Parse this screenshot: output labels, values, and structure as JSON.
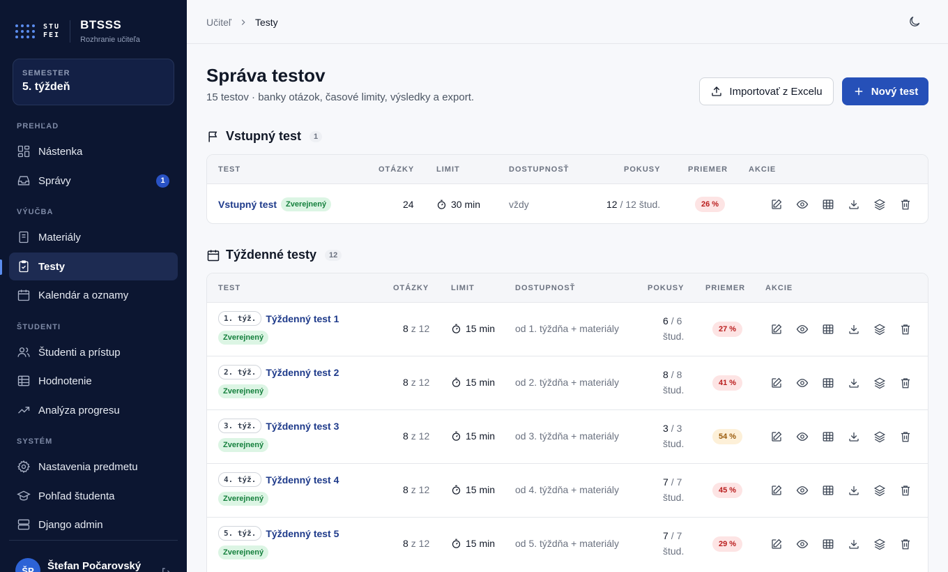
{
  "sidebar": {
    "logo_line1": "STU",
    "logo_line2": "FEI",
    "app_title": "BTSSS",
    "app_subtitle": "Rozhranie učiteľa",
    "semester_label": "SEMESTER",
    "semester_value": "5. týždeň",
    "sections": {
      "overview": "PREHĽAD",
      "teaching": "VÝUČBA",
      "students": "ŠTUDENTI",
      "system": "SYSTÉM"
    },
    "items": {
      "dashboard": "Nástenka",
      "messages": "Správy",
      "messages_badge": "1",
      "materials": "Materiály",
      "tests": "Testy",
      "calendar": "Kalendár a oznamy",
      "students_access": "Študenti a prístup",
      "grading": "Hodnotenie",
      "progress": "Analýza progresu",
      "settings": "Nastavenia predmetu",
      "student_view": "Pohľad študenta",
      "django_admin": "Django admin"
    },
    "user_initials": "ŠP",
    "user_name": "Štefan Počarovský"
  },
  "breadcrumb": {
    "parent": "Učiteľ",
    "current": "Testy"
  },
  "page": {
    "title": "Správa testov",
    "subtitle": "15 testov · banky otázok, časové limity, výsledky a export.",
    "import_label": "Importovať z Excelu",
    "new_label": "Nový test"
  },
  "columns": {
    "test": "TEST",
    "questions": "OTÁZKY",
    "limit": "LIMIT",
    "availability": "DOSTUPNOSŤ",
    "attempts": "POKUSY",
    "average": "PRIEMER",
    "actions": "AKCIE"
  },
  "entry_section": {
    "title": "Vstupný test",
    "count": "1",
    "row": {
      "name": "Vstupný test",
      "status": "Zverejnený",
      "questions": "24",
      "limit": "30 min",
      "availability": "vždy",
      "attempts_done": "12",
      "attempts_total": "/ 12 štud.",
      "average": "26 %"
    }
  },
  "weekly_section": {
    "title": "Týždenné testy",
    "count": "12",
    "rows": [
      {
        "week": "1. týž.",
        "name": "Týždenný test 1",
        "status": "Zverejnený",
        "q_num": "8",
        "q_of": "z 12",
        "limit": "15 min",
        "availability": "od 1. týždňa + materiály",
        "att_done": "6",
        "att_total": "/ 6",
        "att_unit": "štud.",
        "average": "27 %"
      },
      {
        "week": "2. týž.",
        "name": "Týždenný test 2",
        "status": "Zverejnený",
        "q_num": "8",
        "q_of": "z 12",
        "limit": "15 min",
        "availability": "od 2. týždňa + materiály",
        "att_done": "8",
        "att_total": "/ 8",
        "att_unit": "štud.",
        "average": "41 %"
      },
      {
        "week": "3. týž.",
        "name": "Týždenný test 3",
        "status": "Zverejnený",
        "q_num": "8",
        "q_of": "z 12",
        "limit": "15 min",
        "availability": "od 3. týždňa + materiály",
        "att_done": "3",
        "att_total": "/ 3",
        "att_unit": "štud.",
        "average": "54 %"
      },
      {
        "week": "4. týž.",
        "name": "Týždenný test 4",
        "status": "Zverejnený",
        "q_num": "8",
        "q_of": "z 12",
        "limit": "15 min",
        "availability": "od 4. týždňa + materiály",
        "att_done": "7",
        "att_total": "/ 7",
        "att_unit": "štud.",
        "average": "45 %"
      },
      {
        "week": "5. týž.",
        "name": "Týždenný test 5",
        "status": "Zverejnený",
        "q_num": "8",
        "q_of": "z 12",
        "limit": "15 min",
        "availability": "od 5. týždňa + materiály",
        "att_done": "7",
        "att_total": "/ 7",
        "att_unit": "štud.",
        "average": "29 %"
      }
    ]
  },
  "colors": {
    "sidebar_bg": "#0c1631",
    "primary": "#2650b8",
    "published_green": "#15803d",
    "avg_red": "#b91c1c",
    "avg_amber": "#9a5b0c"
  }
}
